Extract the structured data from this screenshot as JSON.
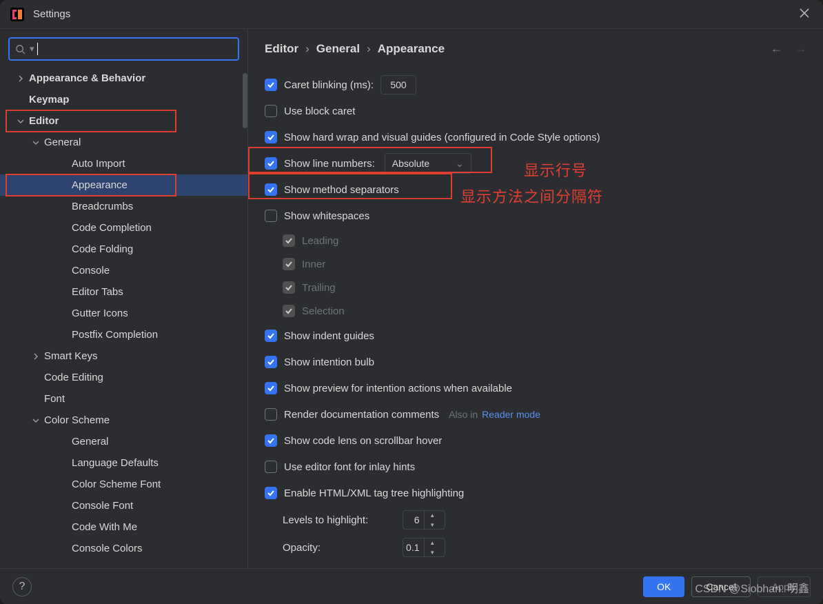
{
  "window": {
    "title": "Settings"
  },
  "search": {
    "value": ""
  },
  "sidebar": {
    "items": [
      {
        "label": "Appearance & Behavior",
        "level": 0,
        "chevron": "right",
        "bold": true
      },
      {
        "label": "Keymap",
        "level": 0,
        "chevron": "",
        "bold": true
      },
      {
        "label": "Editor",
        "level": 0,
        "chevron": "down",
        "bold": true,
        "redbox": true
      },
      {
        "label": "General",
        "level": 1,
        "chevron": "down",
        "bold": false
      },
      {
        "label": "Auto Import",
        "level": 2,
        "chevron": "",
        "bold": false
      },
      {
        "label": "Appearance",
        "level": 2,
        "chevron": "",
        "bold": false,
        "selected": true,
        "redbox": true
      },
      {
        "label": "Breadcrumbs",
        "level": 2,
        "chevron": "",
        "bold": false
      },
      {
        "label": "Code Completion",
        "level": 2,
        "chevron": "",
        "bold": false
      },
      {
        "label": "Code Folding",
        "level": 2,
        "chevron": "",
        "bold": false
      },
      {
        "label": "Console",
        "level": 2,
        "chevron": "",
        "bold": false
      },
      {
        "label": "Editor Tabs",
        "level": 2,
        "chevron": "",
        "bold": false
      },
      {
        "label": "Gutter Icons",
        "level": 2,
        "chevron": "",
        "bold": false
      },
      {
        "label": "Postfix Completion",
        "level": 2,
        "chevron": "",
        "bold": false
      },
      {
        "label": "Smart Keys",
        "level": 1,
        "chevron": "right",
        "bold": false
      },
      {
        "label": "Code Editing",
        "level": 1,
        "chevron": "",
        "bold": false
      },
      {
        "label": "Font",
        "level": 1,
        "chevron": "",
        "bold": false
      },
      {
        "label": "Color Scheme",
        "level": 1,
        "chevron": "down",
        "bold": false
      },
      {
        "label": "General",
        "level": 2,
        "chevron": "",
        "bold": false
      },
      {
        "label": "Language Defaults",
        "level": 2,
        "chevron": "",
        "bold": false
      },
      {
        "label": "Color Scheme Font",
        "level": 2,
        "chevron": "",
        "bold": false
      },
      {
        "label": "Console Font",
        "level": 2,
        "chevron": "",
        "bold": false
      },
      {
        "label": "Code With Me",
        "level": 2,
        "chevron": "",
        "bold": false
      },
      {
        "label": "Console Colors",
        "level": 2,
        "chevron": "",
        "bold": false
      }
    ]
  },
  "breadcrumb": {
    "a": "Editor",
    "b": "General",
    "c": "Appearance"
  },
  "opts": {
    "caret_blinking": {
      "label": "Caret blinking (ms):",
      "value": "500",
      "checked": true
    },
    "use_block_caret": {
      "label": "Use block caret",
      "checked": false
    },
    "show_hard_wrap": {
      "label": "Show hard wrap and visual guides (configured in Code Style options)",
      "checked": true
    },
    "show_line_numbers": {
      "label": "Show line numbers:",
      "checked": true,
      "mode": "Absolute"
    },
    "show_method_separators": {
      "label": "Show method separators",
      "checked": true
    },
    "show_whitespaces": {
      "label": "Show whitespaces",
      "checked": false
    },
    "ws_leading": {
      "label": "Leading",
      "checked": true
    },
    "ws_inner": {
      "label": "Inner",
      "checked": true
    },
    "ws_trailing": {
      "label": "Trailing",
      "checked": true
    },
    "ws_selection": {
      "label": "Selection",
      "checked": true
    },
    "show_indent_guides": {
      "label": "Show indent guides",
      "checked": true
    },
    "show_intention_bulb": {
      "label": "Show intention bulb",
      "checked": true
    },
    "show_preview_intent": {
      "label": "Show preview for intention actions when available",
      "checked": true
    },
    "render_doc_comments": {
      "label": "Render documentation comments",
      "checked": false,
      "hint": "Also in",
      "link": "Reader mode"
    },
    "show_code_lens": {
      "label": "Show code lens on scrollbar hover",
      "checked": true
    },
    "use_editor_font_inlay": {
      "label": "Use editor font for inlay hints",
      "checked": false
    },
    "enable_html_xml_tree": {
      "label": "Enable HTML/XML tag tree highlighting",
      "checked": true
    },
    "levels_to_highlight": {
      "label": "Levels to highlight:",
      "value": "6"
    },
    "opacity": {
      "label": "Opacity:",
      "value": "0.1"
    }
  },
  "annotations": {
    "line_numbers": "显示行号",
    "method_sep": "显示方法之间分隔符"
  },
  "footer": {
    "ok": "OK",
    "cancel": "Cancel",
    "apply": "Apply"
  },
  "watermark": "CSDN @Siobhan. 明鑫"
}
